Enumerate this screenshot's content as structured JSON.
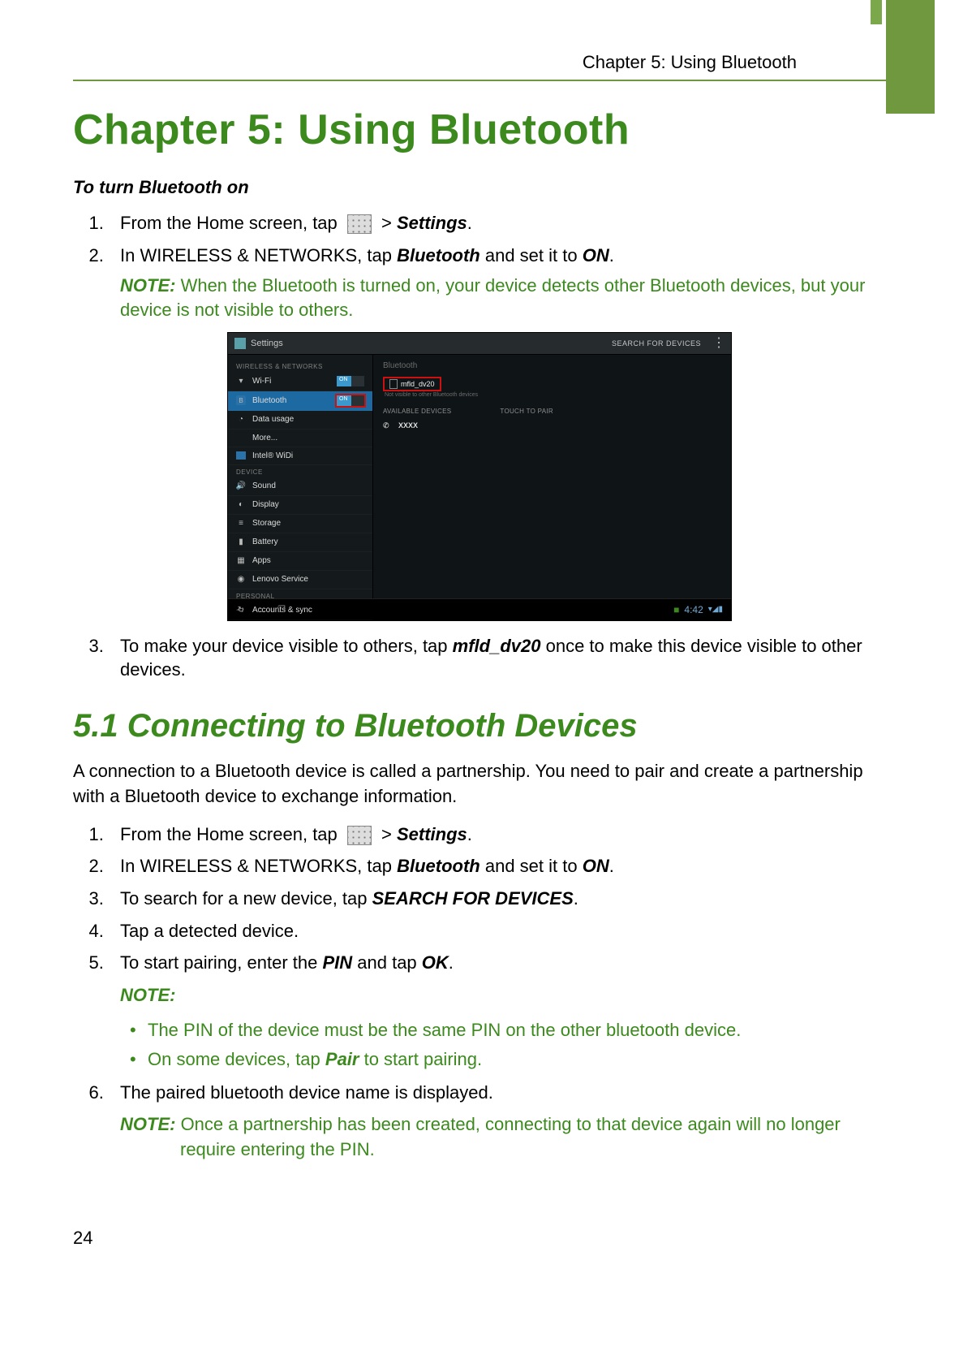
{
  "header": {
    "running_head": "Chapter 5: Using Bluetooth"
  },
  "chapter_title": "Chapter  5: Using Bluetooth",
  "section1": {
    "heading": "To turn Bluetooth on",
    "step1_pre": "From the Home screen, tap ",
    "step1_post": " > ",
    "step1_bold": "Settings",
    "step1_end": ".",
    "step2_pre": "In WIRELESS & NETWORKS, tap ",
    "step2_b1": "Bluetooth",
    "step2_mid": " and set it to ",
    "step2_b2": "ON",
    "step2_end": ".",
    "note1_label": "NOTE:",
    "note1_text": " When the Bluetooth is turned on, your device detects other Bluetooth devices, but your device is not visible to others.",
    "step3_pre": "To make your device visible to others, tap ",
    "step3_b": "mfld_dv20",
    "step3_post": " once to make this device visible to other devices."
  },
  "screenshot": {
    "title": "Settings",
    "search": "SEARCH FOR DEVICES",
    "cat_wireless": "WIRELESS & NETWORKS",
    "wifi": "Wi-Fi",
    "bluetooth": "Bluetooth",
    "datausage": "Data usage",
    "more": "More...",
    "widi": "Intel® WiDi",
    "cat_device": "DEVICE",
    "sound": "Sound",
    "display": "Display",
    "storage": "Storage",
    "battery": "Battery",
    "apps": "Apps",
    "lenovo": "Lenovo Service",
    "cat_personal": "PERSONAL",
    "accounts": "Accounts & sync",
    "on": "ON",
    "right_head": "Bluetooth",
    "device_name": "mfld_dv20",
    "visibility": "Not visible to other Bluetooth devices",
    "available": "AVAILABLE DEVICES",
    "touch": "TOUCH TO PAIR",
    "found": "XXXX",
    "clock": "4:42"
  },
  "subchapter_title": "5.1 Connecting to Bluetooth Devices",
  "section2": {
    "intro": "A connection to a Bluetooth device is called a partnership. You need to pair and create a partnership with a Bluetooth device to exchange information.",
    "s1_pre": "From the Home screen, tap ",
    "s1_post": " > ",
    "s1_b": "Settings",
    "s1_end": ".",
    "s2_pre": "In WIRELESS & NETWORKS, tap ",
    "s2_b1": "Bluetooth",
    "s2_mid": " and set it to ",
    "s2_b2": "ON",
    "s2_end": ".",
    "s3_pre": "To search for a new device, tap ",
    "s3_b": "SEARCH FOR DEVICES",
    "s3_end": ".",
    "s4": "Tap a detected device.",
    "s5_pre": "To start pairing, enter the ",
    "s5_b1": "PIN",
    "s5_mid": " and tap ",
    "s5_b2": "OK",
    "s5_end": ".",
    "note_label": "NOTE:",
    "bullet1": "The PIN of the device must be the same PIN on the other bluetooth device.",
    "bullet2_pre": "On some devices, tap ",
    "bullet2_b": "Pair",
    "bullet2_post": " to start pairing.",
    "s6": "The paired bluetooth device name is displayed.",
    "note2_label": "NOTE:",
    "note2_text": " Once a partnership has been created, connecting to that device again will no longer require entering the PIN."
  },
  "page_number": "24"
}
